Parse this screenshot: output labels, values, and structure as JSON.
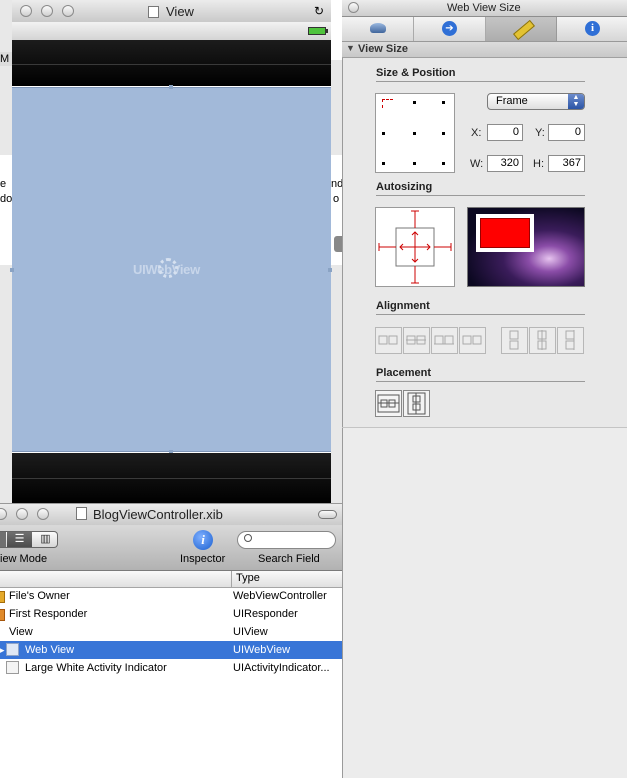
{
  "view_window": {
    "title": "View",
    "embedded_label": "UIWebView"
  },
  "inspector": {
    "title": "Web View Size",
    "tabs": [
      {
        "name": "attributes-tab",
        "icon": "slider-icon"
      },
      {
        "name": "connections-tab",
        "icon": "arrow-circle-icon"
      },
      {
        "name": "size-tab",
        "icon": "ruler-icon"
      },
      {
        "name": "identity-tab",
        "icon": "info-icon"
      }
    ],
    "section": "View Size",
    "size_position": {
      "label": "Size & Position",
      "frame_select": "Frame",
      "x_label": "X:",
      "x": "0",
      "y_label": "Y:",
      "y": "0",
      "w_label": "W:",
      "w": "320",
      "h_label": "H:",
      "h": "367"
    },
    "autosizing_label": "Autosizing",
    "alignment_label": "Alignment",
    "placement_label": "Placement"
  },
  "xib_window": {
    "title": "BlogViewController.xib",
    "view_mode_label": "iew Mode",
    "inspector_label": "Inspector",
    "search_label": "Search Field",
    "type_header": "Type",
    "rows": [
      {
        "name": "File's Owner",
        "type": "WebViewController",
        "selected": false
      },
      {
        "name": "First Responder",
        "type": "UIResponder",
        "selected": false
      },
      {
        "name": "View",
        "type": "UIView",
        "selected": false
      },
      {
        "name": "Web View",
        "type": "UIWebView",
        "selected": true
      },
      {
        "name": "Large White Activity Indicator",
        "type": "UIActivityIndicator...",
        "selected": false
      }
    ]
  },
  "background_fragments": {
    "left": [
      "M",
      "e",
      "do"
    ],
    "right": [
      "nd",
      "o"
    ]
  },
  "colors": {
    "selection": "#3875d7",
    "webview_fill": "#a2b9d9",
    "autosize_red": "#cc0000"
  }
}
